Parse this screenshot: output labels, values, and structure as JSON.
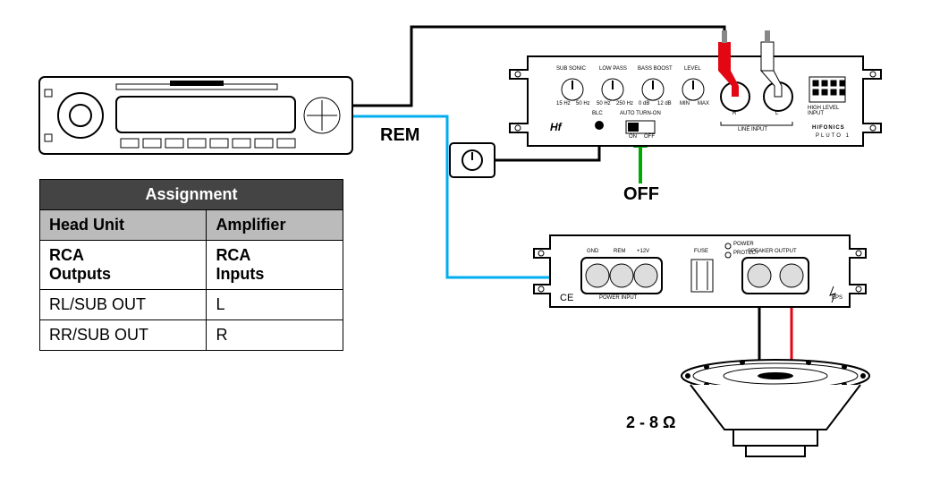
{
  "brand": "HIFONICS",
  "model": "PLUTO 1",
  "labels": {
    "rem": "REM",
    "off": "OFF",
    "speaker_load": "2 - 8 Ω"
  },
  "table": {
    "title": "Assignment",
    "col1": "Head Unit",
    "col2": "Amplifier",
    "rows": [
      {
        "head_unit": "RCA\nOutputs",
        "amp": "RCA\nInputs"
      },
      {
        "head_unit": "RL/SUB OUT",
        "amp": "L"
      },
      {
        "head_unit": "RR/SUB OUT",
        "amp": "R"
      }
    ]
  },
  "amp_top": {
    "knobs": [
      "SUB SONIC",
      "LOW PASS",
      "BASS BOOST",
      "LEVEL"
    ],
    "knob_ranges": [
      [
        "15 Hz",
        "50 Hz"
      ],
      [
        "50 Hz",
        "250 Hz"
      ],
      [
        "0 dB",
        "12 dB"
      ],
      [
        "MIN",
        "MAX"
      ]
    ],
    "blc": "BLC",
    "auto_turn_on": "AUTO TURN-ON",
    "auto_switch": [
      "ON",
      "OFF"
    ],
    "line_input": "LINE INPUT",
    "r": "R",
    "l": "L",
    "high_level": "HIGH LEVEL\nINPUT",
    "logo": "Hf"
  },
  "amp_bottom": {
    "gnd": "GND",
    "rem": "REM",
    "v12": "+12V",
    "fuse": "FUSE",
    "power_input": "POWER INPUT",
    "speaker_output": "SPEAKER OUTPUT",
    "power": "POWER",
    "protect": "PROTECT",
    "ce": "CE",
    "eps": "EPS"
  }
}
